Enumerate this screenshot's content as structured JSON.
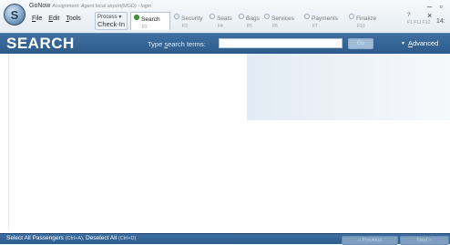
{
  "app": {
    "title": "GoNow",
    "subtitle": "Assignment: Agent local airport(MGD) - login",
    "logo_letter": "S"
  },
  "menu": {
    "file": "File",
    "edit": "Edit",
    "tools": "Tools"
  },
  "process": {
    "label": "Process",
    "name": "Check-In"
  },
  "tabs": [
    {
      "label": "Search",
      "key": "F2"
    },
    {
      "label": "Security",
      "key": "F3"
    },
    {
      "label": "Seats",
      "key": "F4"
    },
    {
      "label": "Bags",
      "key": "F5"
    },
    {
      "label": "Services",
      "key": "F6"
    },
    {
      "label": "Payments",
      "key": "F7"
    },
    {
      "label": "Finalize",
      "key": "F10"
    }
  ],
  "utils": {
    "help": "?",
    "keys": "F1 F11 F12"
  },
  "window": {
    "controls": "– ▫ ×",
    "clock": "14:"
  },
  "search": {
    "title": "SEARCH",
    "label_prefix": "Type ",
    "label_ul": "s",
    "label_suffix": "earch terms:",
    "input_value": "",
    "go": "Go",
    "advanced_ul": "A",
    "advanced_rest": "dvanced"
  },
  "status": {
    "select_all": "Select All Passengers",
    "select_all_shortcut": "(Ctrl+A),",
    "deselect_all": "Deselect All",
    "deselect_all_shortcut": "(Ctrl+D)",
    "previous": "« Previous",
    "next": "Next »"
  }
}
